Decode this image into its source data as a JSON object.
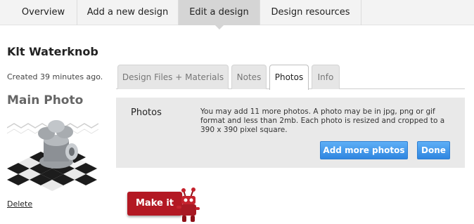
{
  "nav": {
    "tabs": [
      {
        "label": "Overview"
      },
      {
        "label": "Add a new design"
      },
      {
        "label": "Edit a design",
        "active": true
      },
      {
        "label": "Design resources"
      }
    ]
  },
  "design": {
    "title": "Klt Waterknob",
    "created": "Created 39 minutes ago."
  },
  "sidebar": {
    "main_photo_heading": "Main Photo",
    "delete_label": "Delete"
  },
  "tabs": [
    {
      "label": "Design Files + Materials"
    },
    {
      "label": "Notes"
    },
    {
      "label": "Photos",
      "active": true
    },
    {
      "label": "Info"
    }
  ],
  "photos_panel": {
    "heading": "Photos",
    "description": "You may add 11 more photos. A photo may be in jpg, png or gif format and less than 2mb. Each photo is resized and cropped to a 390 x 390 pixel square.",
    "add_button": "Add more photos",
    "done_button": "Done"
  },
  "make_it": {
    "label": "Make it"
  },
  "colors": {
    "accent_blue": "#2f86e0",
    "make_it_red": "#b31823",
    "active_nav": "#d5d5d5"
  }
}
